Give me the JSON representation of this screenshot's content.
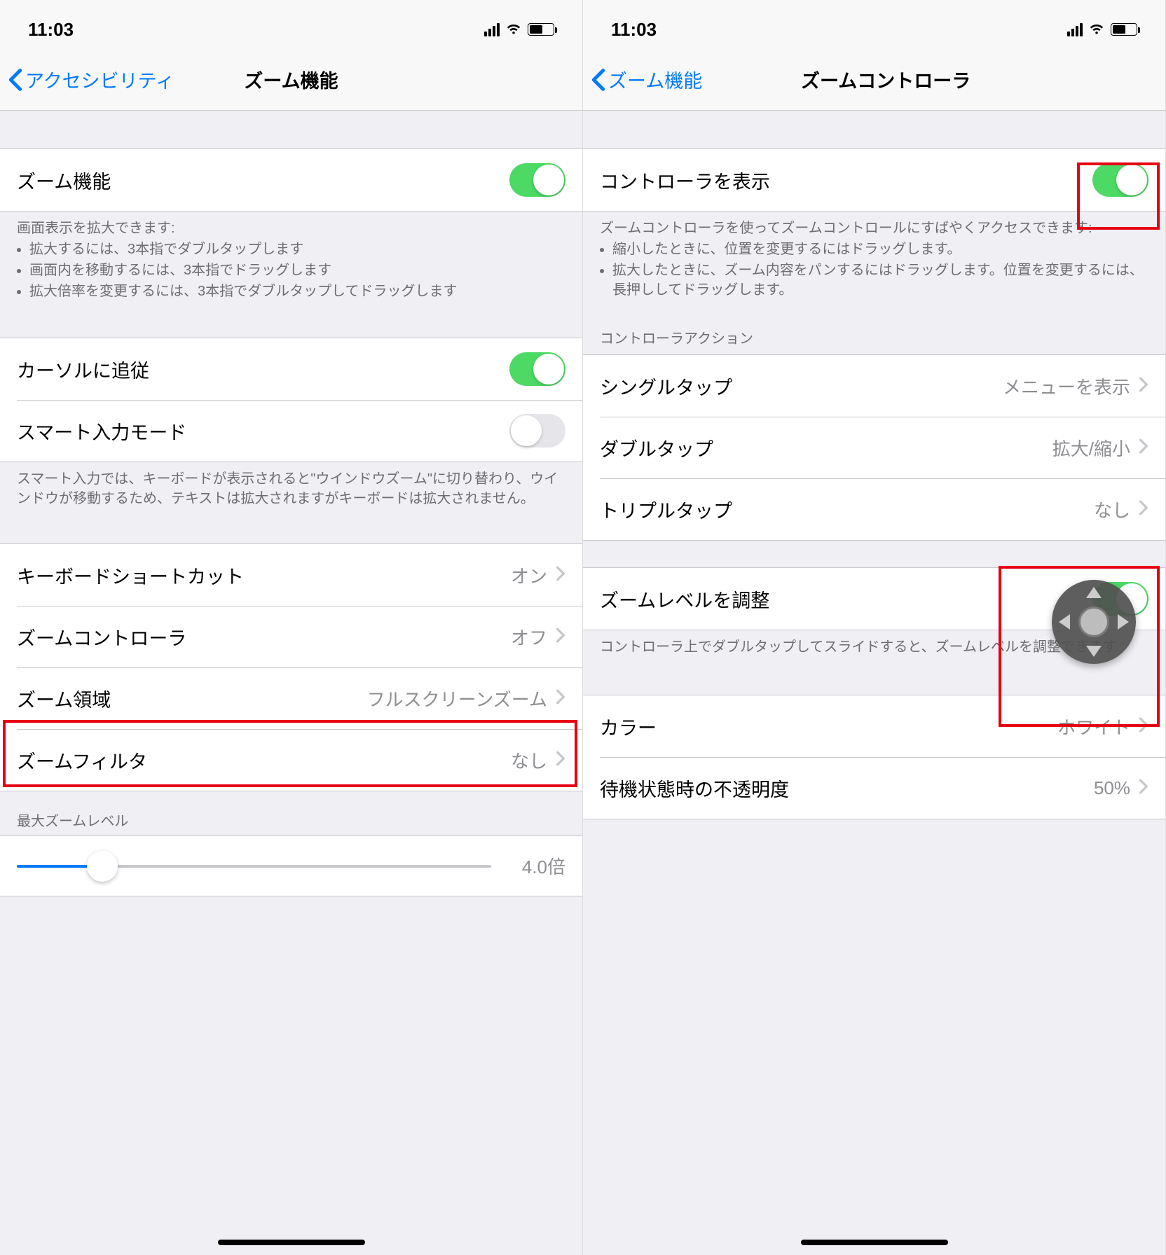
{
  "left": {
    "status": {
      "time": "11:03"
    },
    "nav": {
      "back": "アクセシビリティ",
      "title": "ズーム機能"
    },
    "zoomToggle": {
      "label": "ズーム機能"
    },
    "zoomHelp": {
      "intro": "画面表示を拡大できます:",
      "b1": "拡大するには、3本指でダブルタップします",
      "b2": "画面内を移動するには、3本指でドラッグします",
      "b3": "拡大倍率を変更するには、3本指でダブルタップしてドラッグします"
    },
    "followCursor": "カーソルに追従",
    "smartTyping": "スマート入力モード",
    "smartHelp": "スマート入力では、キーボードが表示されると\"ウインドウズーム\"に切り替わり、ウインドウが移動するため、テキストは拡大されますがキーボードは拡大されません。",
    "kbShortcut": {
      "label": "キーボードショートカット",
      "value": "オン"
    },
    "controller": {
      "label": "ズームコントローラ",
      "value": "オフ"
    },
    "region": {
      "label": "ズーム領域",
      "value": "フルスクリーンズーム"
    },
    "filter": {
      "label": "ズームフィルタ",
      "value": "なし"
    },
    "maxZoom": {
      "header": "最大ズームレベル",
      "value": "4.0倍"
    }
  },
  "right": {
    "status": {
      "time": "11:03"
    },
    "nav": {
      "back": "ズーム機能",
      "title": "ズームコントローラ"
    },
    "show": {
      "label": "コントローラを表示"
    },
    "showHelp": {
      "intro": "ズームコントローラを使ってズームコントロールにすばやくアクセスできます:",
      "b1": "縮小したときに、位置を変更するにはドラッグします。",
      "b2": "拡大したときに、ズーム内容をパンするにはドラッグします。位置を変更するには、長押ししてドラッグします。"
    },
    "actionsHeader": "コントローラアクション",
    "singleTap": {
      "label": "シングルタップ",
      "value": "メニューを表示"
    },
    "doubleTap": {
      "label": "ダブルタップ",
      "value": "拡大/縮小"
    },
    "tripleTap": {
      "label": "トリプルタップ",
      "value": "なし"
    },
    "adjust": {
      "label": "ズームレベルを調整"
    },
    "adjustHelp": "コントローラ上でダブルタップしてスライドすると、ズームレベルを調整できます",
    "color": {
      "label": "カラー",
      "value": "ホワイト"
    },
    "opacity": {
      "label": "待機状態時の不透明度",
      "value": "50%"
    }
  }
}
